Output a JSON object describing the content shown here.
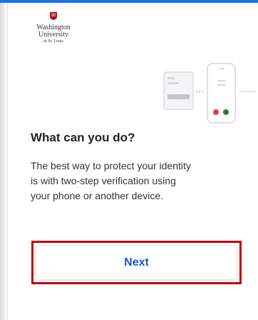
{
  "logo": {
    "line1": "Washington",
    "line2": "University",
    "line3": "in St. Louis",
    "crest_color": "#a51417"
  },
  "content": {
    "heading": "What can you do?",
    "description_lines": [
      "The best way to protect your identity",
      "is with two-step verification using",
      "your phone or another device."
    ]
  },
  "next_button": {
    "label": "Next",
    "text_color": "#1a56c7",
    "highlight_color": "#c00000"
  },
  "colors": {
    "accent": "#1a73e8",
    "red_dot": "#e53935",
    "green_dot": "#2e7d32"
  }
}
